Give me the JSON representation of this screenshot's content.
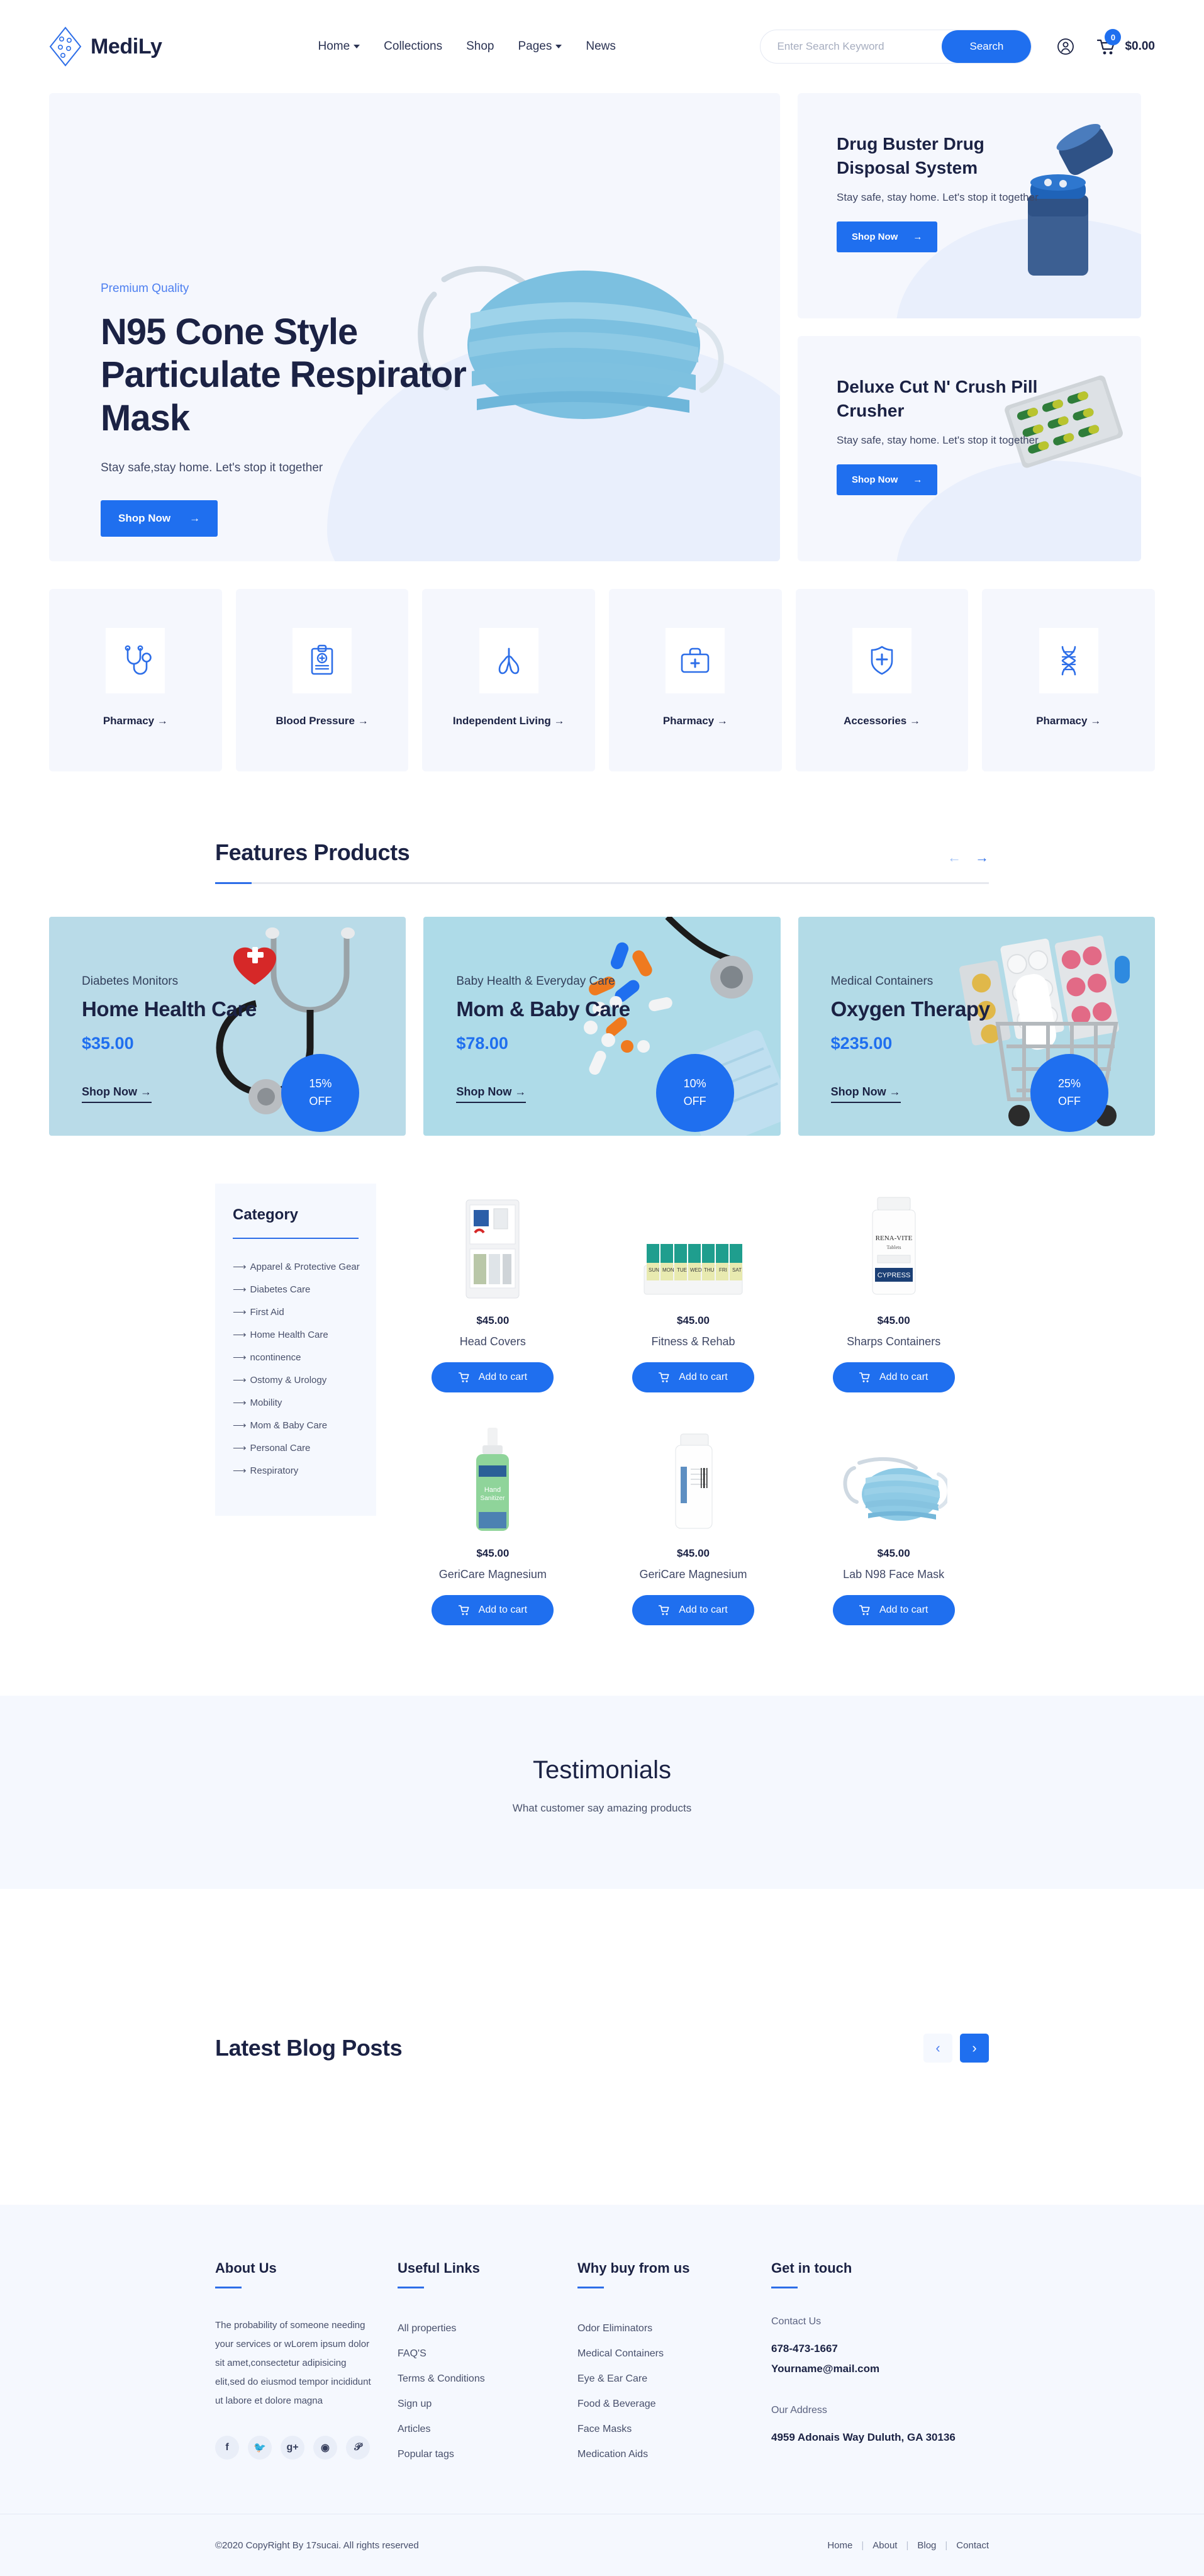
{
  "header": {
    "brand": "MediLy",
    "nav": [
      {
        "label": "Home",
        "caret": true
      },
      {
        "label": "Collections",
        "caret": false
      },
      {
        "label": "Shop",
        "caret": false
      },
      {
        "label": "Pages",
        "caret": true
      },
      {
        "label": "News",
        "caret": false
      }
    ],
    "search": {
      "placeholder": "Enter Search Keyword",
      "value": "",
      "button": "Search"
    },
    "cart": {
      "count": "0",
      "total": "$0.00"
    }
  },
  "hero": {
    "eyebrow": "Premium Quality",
    "title": "N95 Cone Style Particulate Respirator Mask",
    "subtitle": "Stay safe,stay home. Let's stop it together",
    "cta": "Shop Now"
  },
  "promos": [
    {
      "title": "Drug Buster Drug Disposal System",
      "subtitle": "Stay safe, stay home. Let's stop it together",
      "cta": "Shop Now"
    },
    {
      "title": "Deluxe Cut N' Crush Pill Crusher",
      "subtitle": "Stay safe, stay home. Let's stop it together",
      "cta": "Shop Now"
    }
  ],
  "categories": [
    {
      "label": "Pharmacy",
      "icon": "stethoscope-icon"
    },
    {
      "label": "Blood Pressure",
      "icon": "clipboard-medical-icon"
    },
    {
      "label": "Independent Living",
      "icon": "lungs-icon"
    },
    {
      "label": "Pharmacy",
      "icon": "medical-bag-icon"
    },
    {
      "label": "Accessories",
      "icon": "shield-medical-icon"
    },
    {
      "label": "Pharmacy",
      "icon": "dna-icon"
    }
  ],
  "features_section": {
    "title": "Features Products",
    "prev_icon": "arrow-left-icon",
    "next_icon": "arrow-right-icon"
  },
  "feature_cards": [
    {
      "category": "Diabetes Monitors",
      "name": "Home Health Care",
      "price": "$35.00",
      "cta": "Shop Now",
      "discount_pct": "15%",
      "discount_word": "OFF",
      "bg": "#b9dbe8"
    },
    {
      "category": "Baby Health & Everyday Care",
      "name": "Mom & Baby Care",
      "price": "$78.00",
      "cta": "Shop Now",
      "discount_pct": "10%",
      "discount_word": "OFF",
      "bg": "#aedbe8"
    },
    {
      "category": "Medical Containers",
      "name": "Oxygen Therapy",
      "price": "$235.00",
      "cta": "Shop Now",
      "discount_pct": "25%",
      "discount_word": "OFF",
      "bg": "#b3dbe7"
    }
  ],
  "category_panel": {
    "title": "Category",
    "items": [
      "Apparel & Protective Gear",
      "Diabetes Care",
      "First Aid",
      "Home Health Care",
      "ncontinence",
      "Ostomy & Urology",
      "Mobility",
      "Mom & Baby Care",
      "Personal Care",
      "Respiratory"
    ]
  },
  "products": [
    {
      "price": "$45.00",
      "name": "Head Covers",
      "cta": "Add to cart",
      "image": "first-aid-kit-image"
    },
    {
      "price": "$45.00",
      "name": "Fitness & Rehab",
      "cta": "Add to cart",
      "image": "weekly-pill-organizer-image"
    },
    {
      "price": "$45.00",
      "name": "Sharps Containers",
      "cta": "Add to cart",
      "image": "vitamin-bottle-image"
    },
    {
      "price": "$45.00",
      "name": "GeriCare Magnesium",
      "cta": "Add to cart",
      "image": "hand-sanitizer-image"
    },
    {
      "price": "$45.00",
      "name": "GeriCare Magnesium",
      "cta": "Add to cart",
      "image": "white-medicine-bottle-image"
    },
    {
      "price": "$45.00",
      "name": "Lab N98 Face Mask",
      "cta": "Add to cart",
      "image": "surgical-face-mask-image"
    }
  ],
  "testimonials": {
    "title": "Testimonials",
    "subtitle": "What customer say amazing products"
  },
  "blog": {
    "title": "Latest Blog Posts",
    "prev_icon": "chevron-left-icon",
    "next_icon": "chevron-right-icon"
  },
  "footer": {
    "about": {
      "title": "About Us",
      "text": "The probability of someone needing your services or wLorem ipsum dolor sit amet,consectetur adipisicing elit,sed do eiusmod tempor incididunt ut labore et dolore magna",
      "socials": [
        "facebook-icon",
        "twitter-icon",
        "google-plus-icon",
        "dribbble-icon",
        "pinterest-icon"
      ]
    },
    "useful_links": {
      "title": "Useful Links",
      "items": [
        "All properties",
        "FAQ'S",
        "Terms & Conditions",
        "Sign up",
        "Articles",
        "Popular tags"
      ]
    },
    "why_buy": {
      "title": "Why buy from us",
      "items": [
        "Odor Eliminators",
        "Medical Containers",
        "Eye & Ear Care",
        "Food & Beverage",
        "Face Masks",
        "Medication Aids"
      ]
    },
    "get_in_touch": {
      "title": "Get in touch",
      "contact_label": "Contact Us",
      "phone": "678-473-1667",
      "email": "Yourname@mail.com",
      "address_label": "Our Address",
      "address": "4959 Adonais Way Duluth, GA 30136"
    },
    "copyright": "©2020 CopyRight By 17sucai. All rights reserved",
    "bottom_links": [
      "Home",
      "About",
      "Blog",
      "Contact"
    ]
  },
  "colors": {
    "accent": "#1f6fef",
    "dark": "#1b2244",
    "light_bg": "#f5f7fd",
    "panel_bg": "#f5f8fe"
  }
}
